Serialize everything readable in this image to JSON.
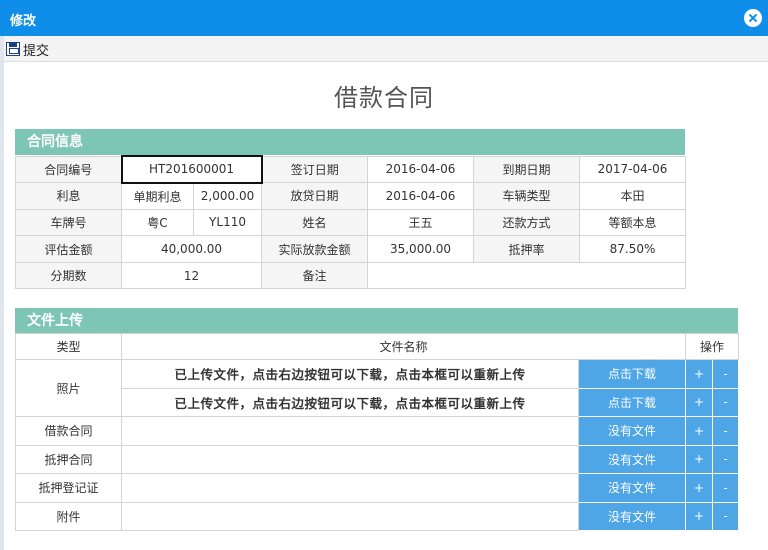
{
  "window": {
    "title": "修改"
  },
  "toolbar": {
    "submit_label": "提交"
  },
  "document": {
    "title": "借款合同"
  },
  "contract_info": {
    "section_title": "合同信息",
    "contract_no_label": "合同编号",
    "contract_no": "HT201600001",
    "sign_date_label": "签订日期",
    "sign_date": "2016-04-06",
    "due_date_label": "到期日期",
    "due_date": "2017-04-06",
    "interest_label": "利息",
    "interest_type": "单期利息",
    "interest_amount": "2,000.00",
    "loan_date_label": "放贷日期",
    "loan_date": "2016-04-06",
    "vehicle_type_label": "车辆类型",
    "vehicle_type": "本田",
    "plate_label": "车牌号",
    "plate_prefix": "粤C",
    "plate_number": "YL110",
    "name_label": "姓名",
    "name": "王五",
    "repay_method_label": "还款方式",
    "repay_method": "等额本息",
    "appraisal_label": "评估金额",
    "appraisal": "40,000.00",
    "actual_loan_label": "实际放款金额",
    "actual_loan": "35,000.00",
    "mortgage_rate_label": "抵押率",
    "mortgage_rate": "87.50%",
    "installments_label": "分期数",
    "installments": "12",
    "remark_label": "备注",
    "remark": ""
  },
  "files": {
    "section_title": "文件上传",
    "headers": {
      "type": "类型",
      "name": "文件名称",
      "ops": "操作"
    },
    "plus": "+",
    "minus": "-",
    "rows": [
      {
        "type": "照片",
        "name": "已上传文件，点击右边按钮可以下载，点击本框可以重新上传",
        "action": "点击下载"
      },
      {
        "type": "",
        "name": "已上传文件，点击右边按钮可以下载，点击本框可以重新上传",
        "action": "点击下载"
      },
      {
        "type": "借款合同",
        "name": "",
        "action": "没有文件"
      },
      {
        "type": "抵押合同",
        "name": "",
        "action": "没有文件"
      },
      {
        "type": "抵押登记证",
        "name": "",
        "action": "没有文件"
      },
      {
        "type": "附件",
        "name": "",
        "action": "没有文件"
      }
    ]
  }
}
